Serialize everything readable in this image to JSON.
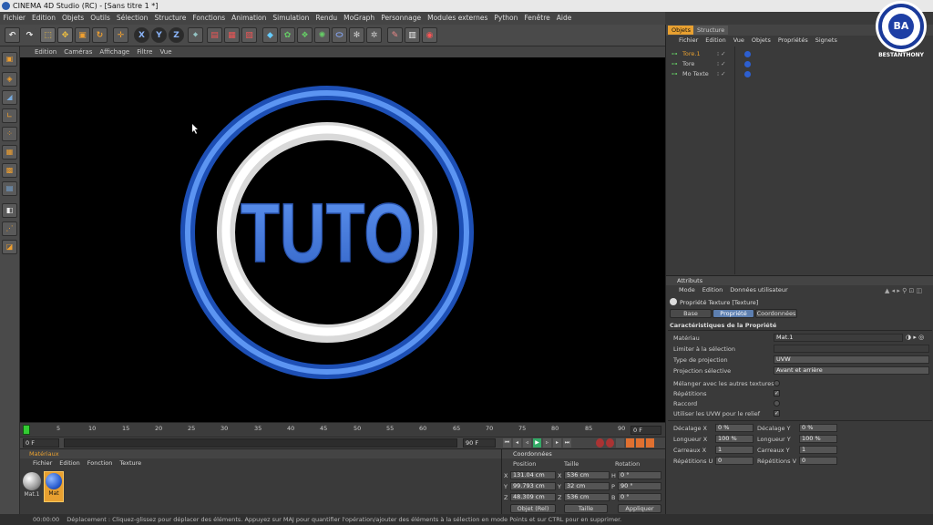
{
  "window": {
    "title": "CINEMA 4D Studio (RC) - [Sans titre 1 *]"
  },
  "menubar": [
    "Fichier",
    "Edition",
    "Objets",
    "Outils",
    "Sélection",
    "Structure",
    "Fonctions",
    "Animation",
    "Simulation",
    "Rendu",
    "MoGraph",
    "Personnage",
    "Modules externes",
    "Python",
    "Fenêtre",
    "Aide"
  ],
  "toolbar": {
    "axis_x": "X",
    "axis_y": "Y",
    "axis_z": "Z"
  },
  "viewport": {
    "menu": [
      "Edition",
      "Caméras",
      "Affichage",
      "Filtre",
      "Vue"
    ],
    "text3d": "TUTO"
  },
  "watermark": {
    "initials": "BA",
    "name": "BESTANTHONY"
  },
  "timeline": {
    "ticks": [
      "0",
      "5",
      "10",
      "15",
      "20",
      "25",
      "30",
      "35",
      "40",
      "45",
      "50",
      "55",
      "60",
      "65",
      "70",
      "75",
      "80",
      "85",
      "90"
    ],
    "end_label": "0 F"
  },
  "transport": {
    "current": "0 F",
    "end": "90 F"
  },
  "materials": {
    "title": "Matériaux",
    "menu": [
      "Fichier",
      "Edition",
      "Fonction",
      "Texture"
    ],
    "items": [
      {
        "name": "Mat.1"
      },
      {
        "name": "Mat"
      }
    ]
  },
  "coords": {
    "title": "Coordonnées",
    "headers": [
      "Position",
      "Taille",
      "Rotation"
    ],
    "rows": [
      {
        "axis": "X",
        "pos": "131.04 cm",
        "size_axis": "X",
        "size": "536 cm",
        "rot_axis": "H",
        "rot": "0 °"
      },
      {
        "axis": "Y",
        "pos": "99.793 cm",
        "size_axis": "Y",
        "size": "32 cm",
        "rot_axis": "P",
        "rot": "90 °"
      },
      {
        "axis": "Z",
        "pos": "48.309 cm",
        "size_axis": "Z",
        "size": "536 cm",
        "rot_axis": "B",
        "rot": "0 °"
      }
    ],
    "mode": "Objet (Rel)",
    "mode2": "Taille",
    "apply": "Appliquer"
  },
  "objects": {
    "tabs": [
      "Objets",
      "Structure"
    ],
    "menu": [
      "Fichier",
      "Edition",
      "Vue",
      "Objets",
      "Propriétés",
      "Signets"
    ],
    "items": [
      "Tore.1",
      "Tore",
      "Mo Texte"
    ]
  },
  "attributes": {
    "title": "Attributs",
    "menu": [
      "Mode",
      "Edition",
      "Données utilisateur"
    ],
    "object_label": "Propriété Texture [Texture]",
    "tabs": [
      "Base",
      "Propriété",
      "Coordonnées"
    ],
    "section": "Caractéristiques de la Propriété",
    "fields": [
      {
        "label": "Matériau",
        "value": "Mat.1"
      },
      {
        "label": "Limiter à la sélection",
        "value": ""
      },
      {
        "label": "Type de projection",
        "value": "UVW"
      },
      {
        "label": "Projection sélective",
        "value": "Avant et arrière"
      }
    ],
    "checks": [
      {
        "label": "Mélanger avec les autres textures",
        "checked": false
      },
      {
        "label": "Répétitions",
        "checked": true
      },
      {
        "label": "Raccord",
        "checked": false
      },
      {
        "label": "Utiliser les UVW pour le relief",
        "checked": true
      }
    ],
    "offsets": [
      {
        "l1": "Décalage X",
        "v1": "0 %",
        "l2": "Décalage Y",
        "v2": "0 %"
      },
      {
        "l1": "Longueur X",
        "v1": "100 %",
        "l2": "Longueur Y",
        "v2": "100 %"
      },
      {
        "l1": "Carreaux X",
        "v1": "1",
        "l2": "Carreaux Y",
        "v2": "1"
      },
      {
        "l1": "Répétitions U",
        "v1": "0",
        "l2": "Répétitions V",
        "v2": "0"
      }
    ]
  },
  "status": {
    "time": "00:00:00",
    "message": "Déplacement : Cliquez-glissez pour déplacer des éléments. Appuyez sur MAJ pour quantifier l'opération/ajouter des éléments à la sélection en mode Points et sur CTRL pour en supprimer."
  },
  "colors": {
    "ring_blue": "#3a78e6",
    "ring_white": "#f4f4f4",
    "text_blue": "#4f86e8",
    "active_tab": "#5d7fb0"
  }
}
